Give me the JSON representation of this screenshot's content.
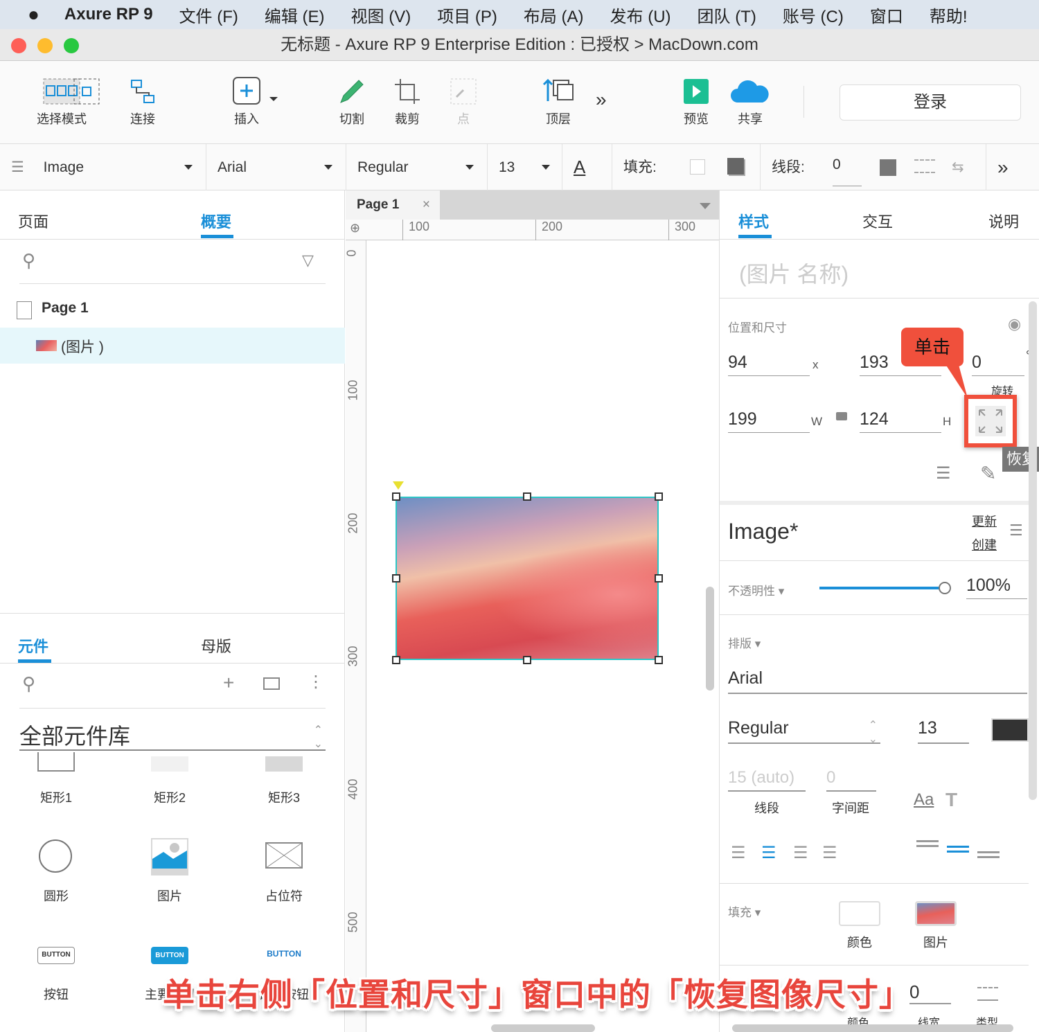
{
  "menubar": {
    "app": "Axure RP 9",
    "items": [
      "文件 (F)",
      "编辑 (E)",
      "视图 (V)",
      "项目 (P)",
      "布局 (A)",
      "发布 (U)",
      "团队 (T)",
      "账号 (C)",
      "窗口",
      "帮助!"
    ]
  },
  "window_title": "无标题 - Axure RP 9 Enterprise Edition : 已授权 > MacDown.com",
  "toolbar": {
    "select_mode": "选择模式",
    "connect": "连接",
    "insert": "插入",
    "cut": "切割",
    "crop": "裁剪",
    "point": "点",
    "top_layer": "顶层",
    "preview": "预览",
    "share": "共享",
    "login": "登录"
  },
  "format_bar": {
    "style": "Image",
    "font": "Arial",
    "weight": "Regular",
    "size": "13",
    "fill_label": "填充:",
    "line_label": "线段:",
    "line_value": "0"
  },
  "left_top": {
    "tabs": [
      "页面",
      "概要"
    ],
    "page": "Page 1",
    "item": "(图片 )"
  },
  "left_bottom": {
    "tabs": [
      "元件",
      "母版"
    ],
    "library": "全部元件库",
    "widgets": [
      "矩形1",
      "矩形2",
      "矩形3",
      "圆形",
      "图片",
      "占位符",
      "按钮",
      "主要按钮",
      "链接按钮"
    ],
    "button_text": "BUTTON"
  },
  "canvas": {
    "tab": "Page 1",
    "ruler_h": [
      "100",
      "200",
      "300"
    ],
    "ruler_v": [
      "0",
      "100",
      "200",
      "300",
      "400",
      "500"
    ]
  },
  "right": {
    "tabs": [
      "样式",
      "交互",
      "说明"
    ],
    "name_placeholder": "(图片 名称)",
    "pos_size_label": "位置和尺寸",
    "x": "94",
    "x_label": "x",
    "y": "193",
    "rotation": "0",
    "rotation_unit": "°",
    "rotation_label": "旋转",
    "w": "199",
    "w_label": "W",
    "h": "124",
    "h_label": "H",
    "callout": "单击",
    "tooltip": "恢复",
    "style_name": "Image*",
    "update": "更新",
    "create": "创建",
    "opacity_label": "不透明性",
    "opacity": "100%",
    "opacity_value": 1.0,
    "typography_label": "排版",
    "font": "Arial",
    "weight": "Regular",
    "size": "13",
    "line_height": "15 (auto)",
    "line_height_label": "线段",
    "spacing": "0",
    "spacing_label": "字间距",
    "aa": "Aa",
    "fill_label": "填充",
    "fill_color": "颜色",
    "fill_image": "图片",
    "border_value": "0",
    "border_color": "颜色",
    "border_width": "线宽",
    "border_type": "类型"
  },
  "caption": "单击右侧「位置和尺寸」窗口中的「恢复图像尺寸」",
  "colors": {
    "accent": "#1a8fd8",
    "callout": "#f0503c"
  }
}
